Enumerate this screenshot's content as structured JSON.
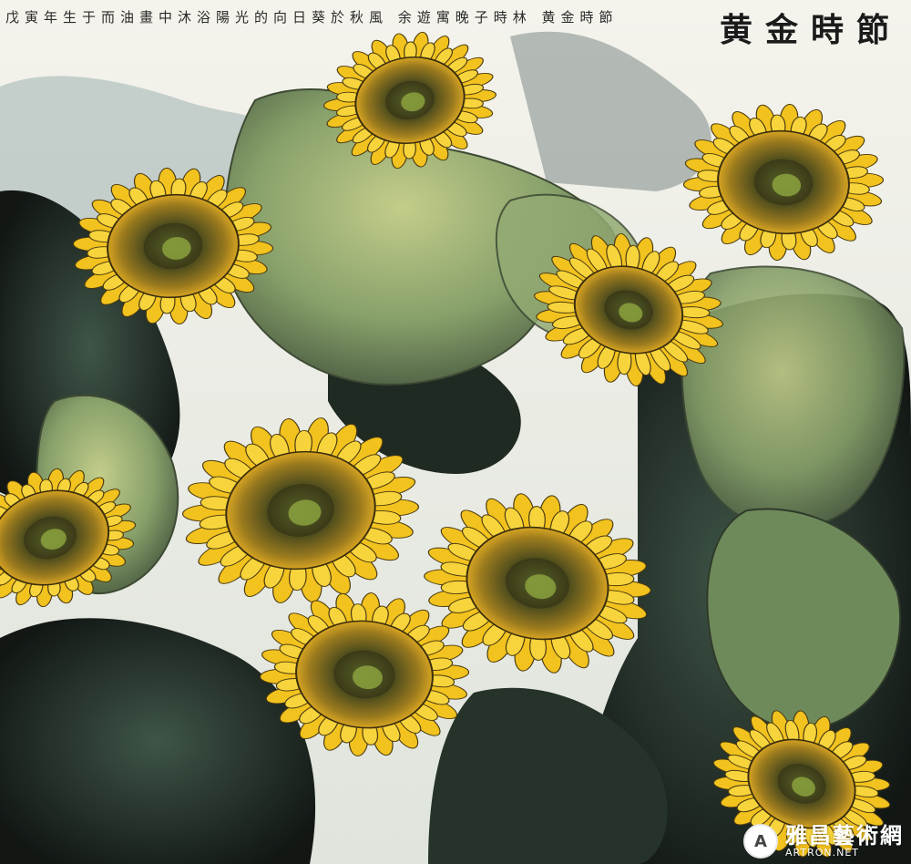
{
  "painting": {
    "title": "黄金時節",
    "inscription": "戊寅年生于而油畫中沐浴陽光的向日葵於秋風 余遊寓晚子時林 黄金時節",
    "watermark_cn": "雅昌藝術網",
    "watermark_url": "ARTRON.NET",
    "logo_glyph": "A",
    "colors": {
      "petal": "#f2c21e",
      "petal_dark": "#c98f10",
      "seed": "#6f6a25",
      "seed_dark": "#2c2a14",
      "leaf": "#8fa66a",
      "leaf_dark": "#31402e",
      "ink": "#1c241d",
      "sky": "#eef0ea"
    }
  }
}
